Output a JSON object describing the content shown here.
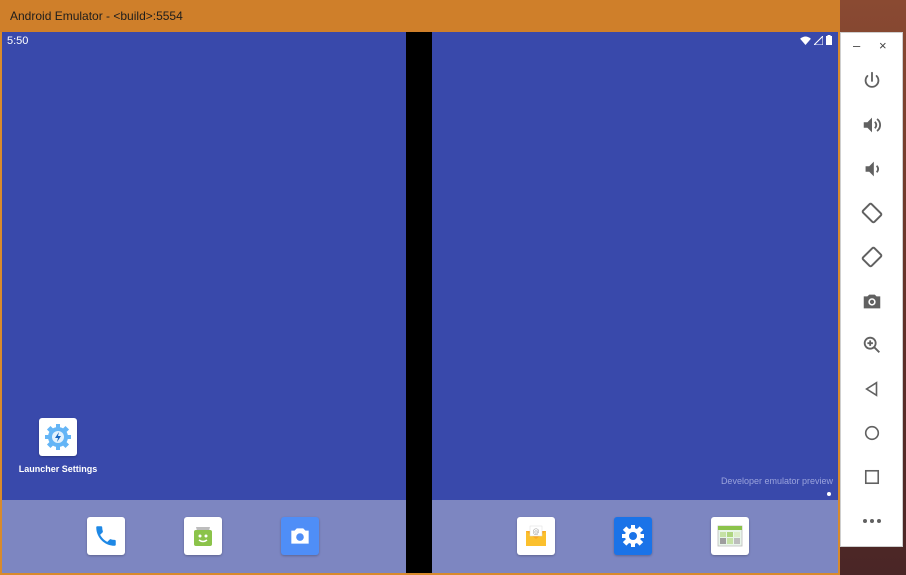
{
  "window": {
    "title": "Android Emulator - <build>:5554"
  },
  "status_bar": {
    "time": "5:50",
    "icons": [
      "wifi-icon",
      "signal-icon",
      "battery-icon"
    ]
  },
  "left_screen": {
    "shortcut": {
      "label": "Launcher Settings",
      "icon": "launcher-settings-icon"
    },
    "dock": [
      "phone-icon",
      "store-icon",
      "camera-icon"
    ]
  },
  "right_screen": {
    "watermark": "Developer emulator preview",
    "dock": [
      "email-icon",
      "settings-icon",
      "gallery-icon"
    ]
  },
  "toolbar": {
    "minimize": "–",
    "close": "×",
    "buttons": [
      "power-icon",
      "volume-up-icon",
      "volume-down-icon",
      "rotate-left-icon",
      "rotate-right-icon",
      "screenshot-icon",
      "zoom-icon",
      "back-icon",
      "home-icon",
      "overview-icon",
      "more-icon"
    ]
  },
  "colors": {
    "title_bar": "#cf7f2a",
    "screen": "#3949ab",
    "dock": "#7d86c1",
    "hinge": "#000000"
  }
}
